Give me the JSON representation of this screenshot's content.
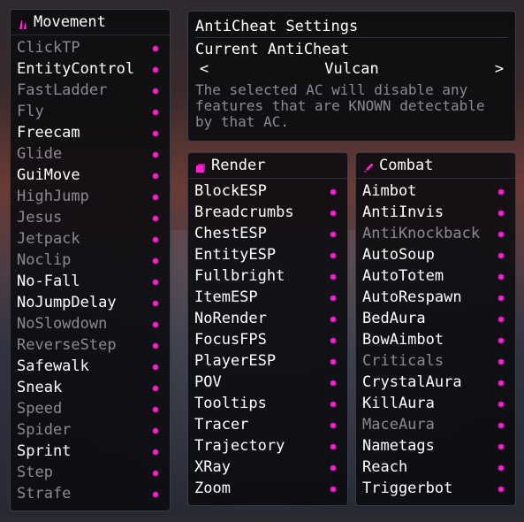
{
  "colors": {
    "accent": "#ff1fd1",
    "disabled_text": "#8a8a8f",
    "panel_bg": "#0c0c10"
  },
  "movement": {
    "title": "Movement",
    "icon": "movement-icon",
    "items": [
      {
        "label": "ClickTP",
        "enabled": false
      },
      {
        "label": "EntityControl",
        "enabled": true
      },
      {
        "label": "FastLadder",
        "enabled": false
      },
      {
        "label": "Fly",
        "enabled": false
      },
      {
        "label": "Freecam",
        "enabled": true
      },
      {
        "label": "Glide",
        "enabled": false
      },
      {
        "label": "GuiMove",
        "enabled": true
      },
      {
        "label": "HighJump",
        "enabled": false
      },
      {
        "label": "Jesus",
        "enabled": false
      },
      {
        "label": "Jetpack",
        "enabled": false
      },
      {
        "label": "Noclip",
        "enabled": false
      },
      {
        "label": "No-Fall",
        "enabled": true
      },
      {
        "label": "NoJumpDelay",
        "enabled": true
      },
      {
        "label": "NoSlowdown",
        "enabled": false
      },
      {
        "label": "ReverseStep",
        "enabled": false
      },
      {
        "label": "Safewalk",
        "enabled": true
      },
      {
        "label": "Sneak",
        "enabled": true
      },
      {
        "label": "Speed",
        "enabled": false
      },
      {
        "label": "Spider",
        "enabled": false
      },
      {
        "label": "Sprint",
        "enabled": true
      },
      {
        "label": "Step",
        "enabled": false
      },
      {
        "label": "Strafe",
        "enabled": false
      }
    ]
  },
  "anticheat": {
    "title": "AntiCheat Settings",
    "current_label": "Current AntiCheat",
    "prev_arrow": "<",
    "value": "Vulcan",
    "next_arrow": ">",
    "description": "The selected AC will disable any features that are KNOWN detectable by that AC."
  },
  "render": {
    "title": "Render",
    "icon": "render-icon",
    "items": [
      {
        "label": "BlockESP",
        "enabled": true
      },
      {
        "label": "Breadcrumbs",
        "enabled": true
      },
      {
        "label": "ChestESP",
        "enabled": true
      },
      {
        "label": "EntityESP",
        "enabled": true
      },
      {
        "label": "Fullbright",
        "enabled": true
      },
      {
        "label": "ItemESP",
        "enabled": true
      },
      {
        "label": "NoRender",
        "enabled": true
      },
      {
        "label": "FocusFPS",
        "enabled": true
      },
      {
        "label": "PlayerESP",
        "enabled": true
      },
      {
        "label": "POV",
        "enabled": true
      },
      {
        "label": "Tooltips",
        "enabled": true
      },
      {
        "label": "Tracer",
        "enabled": true
      },
      {
        "label": "Trajectory",
        "enabled": true
      },
      {
        "label": "XRay",
        "enabled": true
      },
      {
        "label": "Zoom",
        "enabled": true
      }
    ]
  },
  "combat": {
    "title": "Combat",
    "icon": "sword-icon",
    "items": [
      {
        "label": "Aimbot",
        "enabled": true
      },
      {
        "label": "AntiInvis",
        "enabled": true
      },
      {
        "label": "AntiKnockback",
        "enabled": false
      },
      {
        "label": "AutoSoup",
        "enabled": true
      },
      {
        "label": "AutoTotem",
        "enabled": true
      },
      {
        "label": "AutoRespawn",
        "enabled": true
      },
      {
        "label": "BedAura",
        "enabled": true
      },
      {
        "label": "BowAimbot",
        "enabled": true
      },
      {
        "label": "Criticals",
        "enabled": false
      },
      {
        "label": "CrystalAura",
        "enabled": true
      },
      {
        "label": "KillAura",
        "enabled": true
      },
      {
        "label": "MaceAura",
        "enabled": false
      },
      {
        "label": "Nametags",
        "enabled": true
      },
      {
        "label": "Reach",
        "enabled": true
      },
      {
        "label": "Triggerbot",
        "enabled": true
      }
    ]
  },
  "settings_icon": "gear-icon"
}
